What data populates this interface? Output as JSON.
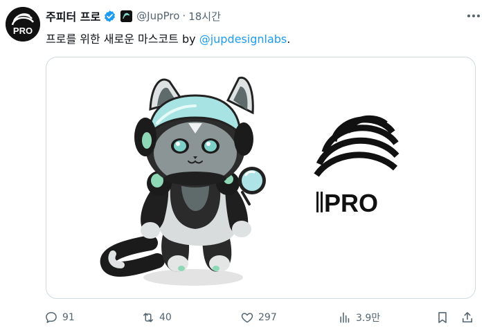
{
  "author": {
    "display_name": "주피터 프로",
    "handle": "@JupPro",
    "separator": "·",
    "time": "18시간",
    "verified": true,
    "avatar_text": "PRO"
  },
  "tweet": {
    "text_prefix": "프로를 위한 새로운 마스코트 by ",
    "mention": "@jupdesignlabs",
    "text_suffix": "."
  },
  "media": {
    "logo_text": "PRO",
    "description_icons": [
      "cat-mascot-illustration",
      "pro-logo"
    ]
  },
  "actions": {
    "replies": "91",
    "reposts": "40",
    "likes": "297",
    "views": "3.9만"
  },
  "colors": {
    "link": "#1d9bf0",
    "muted": "#536471",
    "verified": "#1d9bf0",
    "border": "#cfd9de"
  }
}
